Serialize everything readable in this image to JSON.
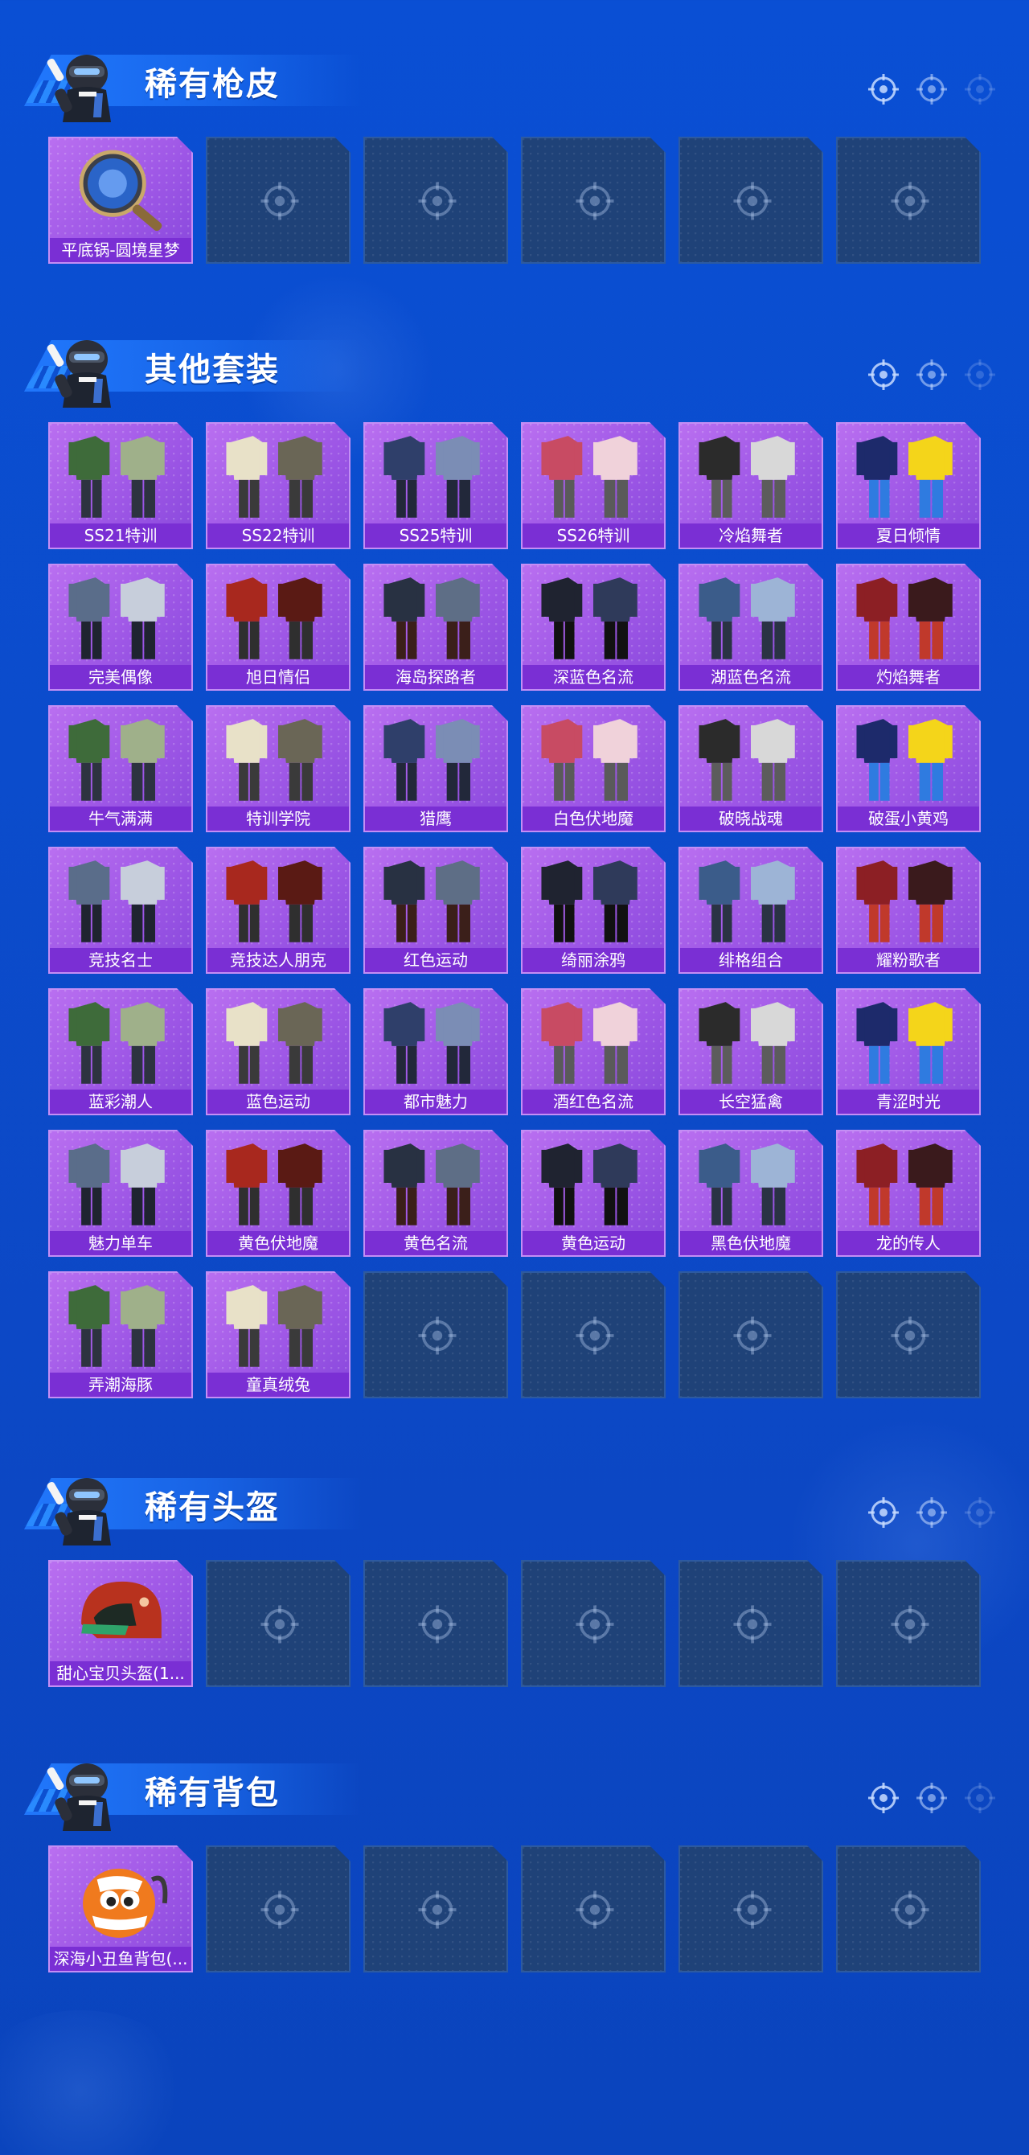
{
  "sections": [
    {
      "title": "稀有枪皮",
      "items": [
        {
          "label": "平底锅-圆境星梦",
          "icon": "frying-pan"
        },
        {
          "label": "",
          "icon": "empty-slot"
        },
        {
          "label": "",
          "icon": "empty-slot"
        },
        {
          "label": "",
          "icon": "empty-slot"
        },
        {
          "label": "",
          "icon": "empty-slot"
        },
        {
          "label": "",
          "icon": "empty-slot"
        }
      ]
    },
    {
      "title": "其他套装",
      "items": [
        {
          "label": "SS21特训",
          "icon": "outfit"
        },
        {
          "label": "SS22特训",
          "icon": "outfit"
        },
        {
          "label": "SS25特训",
          "icon": "outfit"
        },
        {
          "label": "SS26特训",
          "icon": "outfit"
        },
        {
          "label": "冷焰舞者",
          "icon": "outfit"
        },
        {
          "label": "夏日倾情",
          "icon": "outfit"
        },
        {
          "label": "完美偶像",
          "icon": "outfit"
        },
        {
          "label": "旭日情侣",
          "icon": "outfit"
        },
        {
          "label": "海岛探路者",
          "icon": "outfit"
        },
        {
          "label": "深蓝色名流",
          "icon": "outfit"
        },
        {
          "label": "湖蓝色名流",
          "icon": "outfit"
        },
        {
          "label": "灼焰舞者",
          "icon": "outfit"
        },
        {
          "label": "牛气满满",
          "icon": "outfit"
        },
        {
          "label": "特训学院",
          "icon": "outfit"
        },
        {
          "label": "猎鹰",
          "icon": "outfit"
        },
        {
          "label": "白色伏地魔",
          "icon": "outfit"
        },
        {
          "label": "破晓战魂",
          "icon": "outfit"
        },
        {
          "label": "破蛋小黄鸡",
          "icon": "outfit"
        },
        {
          "label": "竞技名士",
          "icon": "outfit"
        },
        {
          "label": "竞技达人朋克",
          "icon": "outfit"
        },
        {
          "label": "红色运动",
          "icon": "outfit"
        },
        {
          "label": "绮丽涂鸦",
          "icon": "outfit"
        },
        {
          "label": "绯格组合",
          "icon": "outfit"
        },
        {
          "label": "耀粉歌者",
          "icon": "outfit"
        },
        {
          "label": "蓝彩潮人",
          "icon": "outfit"
        },
        {
          "label": "蓝色运动",
          "icon": "outfit"
        },
        {
          "label": "都市魅力",
          "icon": "outfit"
        },
        {
          "label": "酒红色名流",
          "icon": "outfit"
        },
        {
          "label": "长空猛禽",
          "icon": "outfit"
        },
        {
          "label": "青涩时光",
          "icon": "outfit"
        },
        {
          "label": "魅力单车",
          "icon": "outfit"
        },
        {
          "label": "黄色伏地魔",
          "icon": "outfit"
        },
        {
          "label": "黄色名流",
          "icon": "outfit"
        },
        {
          "label": "黄色运动",
          "icon": "outfit"
        },
        {
          "label": "黑色伏地魔",
          "icon": "outfit"
        },
        {
          "label": "龙的传人",
          "icon": "outfit"
        },
        {
          "label": "弄潮海豚",
          "icon": "outfit"
        },
        {
          "label": "童真绒兔",
          "icon": "outfit"
        },
        {
          "label": "",
          "icon": "empty-slot"
        },
        {
          "label": "",
          "icon": "empty-slot"
        },
        {
          "label": "",
          "icon": "empty-slot"
        },
        {
          "label": "",
          "icon": "empty-slot"
        }
      ]
    },
    {
      "title": "稀有头盔",
      "items": [
        {
          "label": "甜心宝贝头盔(1...",
          "icon": "helmet"
        },
        {
          "label": "",
          "icon": "empty-slot"
        },
        {
          "label": "",
          "icon": "empty-slot"
        },
        {
          "label": "",
          "icon": "empty-slot"
        },
        {
          "label": "",
          "icon": "empty-slot"
        },
        {
          "label": "",
          "icon": "empty-slot"
        }
      ]
    },
    {
      "title": "稀有背包",
      "items": [
        {
          "label": "深海小丑鱼背包(...",
          "icon": "backpack"
        },
        {
          "label": "",
          "icon": "empty-slot"
        },
        {
          "label": "",
          "icon": "empty-slot"
        },
        {
          "label": "",
          "icon": "empty-slot"
        },
        {
          "label": "",
          "icon": "empty-slot"
        },
        {
          "label": "",
          "icon": "empty-slot"
        }
      ]
    }
  ],
  "colors": {
    "background": "#0b4ccc",
    "tile_filled": "#a05ae6",
    "tile_label": "#7a2fd4",
    "tile_empty": "#1f4278",
    "accent": "#2a8cff"
  }
}
